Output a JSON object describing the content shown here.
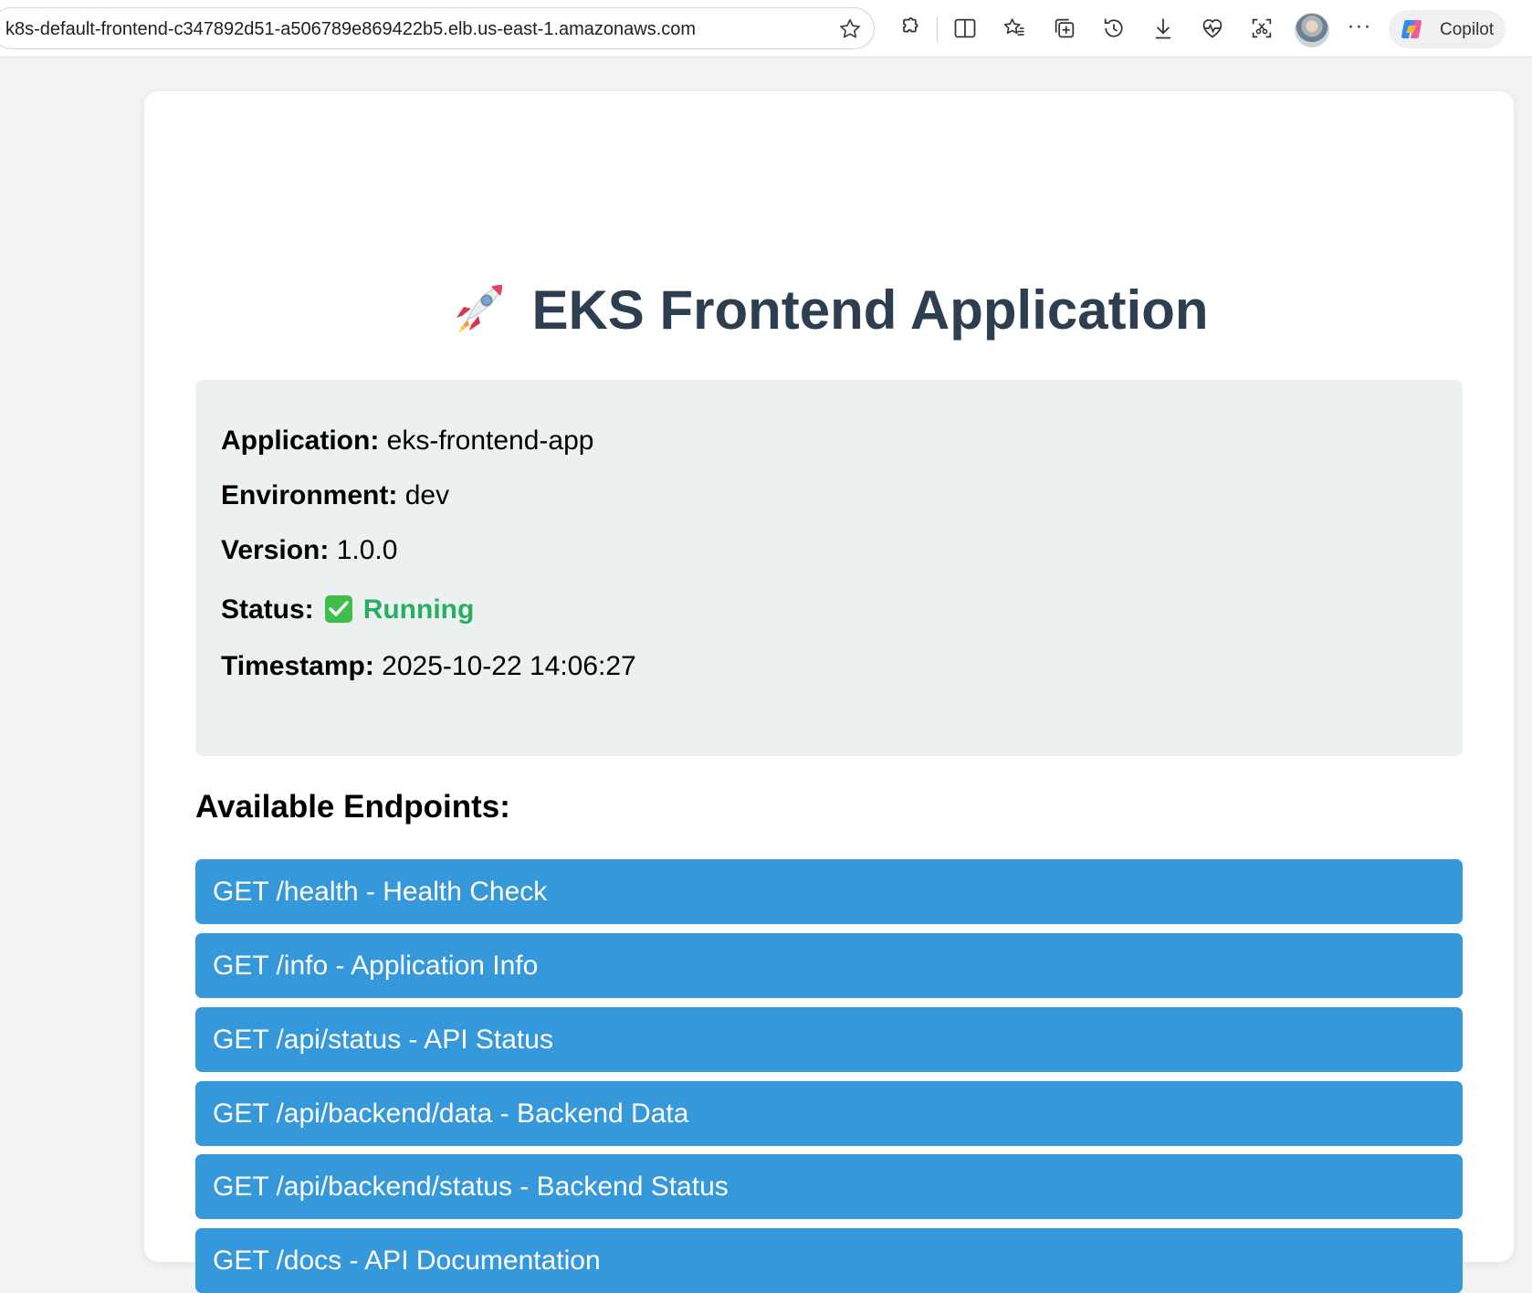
{
  "browser": {
    "url": "k8s-default-frontend-c347892d51-a506789e869422b5.elb.us-east-1.amazonaws.com",
    "toolbar_icons": [
      "favorite-star-icon",
      "extensions-icon",
      "split-screen-icon",
      "favorites-icon",
      "collections-icon",
      "history-icon",
      "downloads-icon",
      "browser-essentials-icon",
      "screenshot-icon",
      "profile-avatar",
      "more-options-icon"
    ],
    "copilot_label": "Copilot"
  },
  "page": {
    "title": "EKS Frontend Application",
    "title_icon": "rocket-icon",
    "info": {
      "application_label": "Application:",
      "application_value": "eks-frontend-app",
      "environment_label": "Environment:",
      "environment_value": "dev",
      "version_label": "Version:",
      "version_value": "1.0.0",
      "status_label": "Status:",
      "status_icon": "check-mark-icon",
      "status_value": "Running",
      "timestamp_label": "Timestamp:",
      "timestamp_value": "2025-10-22 14:06:27"
    },
    "endpoints_heading": "Available Endpoints:",
    "endpoints": [
      "GET /health - Health Check",
      "GET /info - Application Info",
      "GET /api/status - API Status",
      "GET /api/backend/data - Backend Data",
      "GET /api/backend/status - Backend Status",
      "GET /docs - API Documentation"
    ]
  },
  "colors": {
    "title_text": "#2c3e50",
    "info_panel_bg": "#ecf0f1",
    "status_running": "#27ae60",
    "endpoint_bg": "#3498db",
    "endpoint_text": "#ffffff"
  }
}
